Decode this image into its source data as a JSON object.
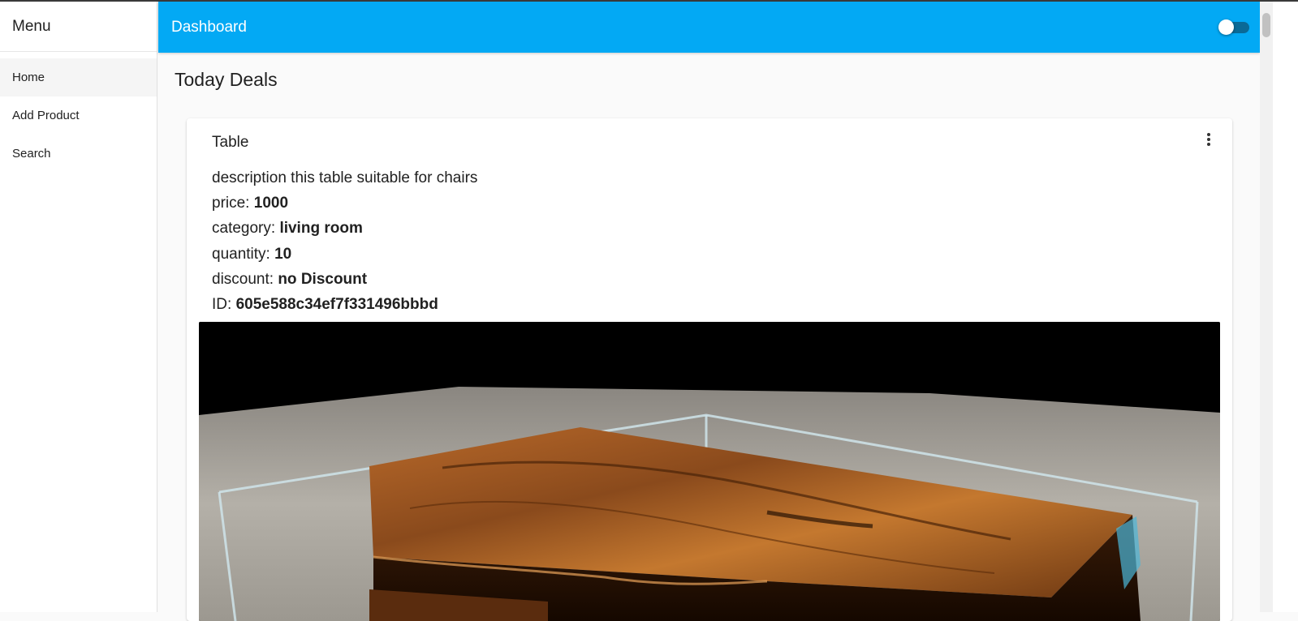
{
  "sidebar": {
    "title": "Menu",
    "items": [
      {
        "label": "Home",
        "active": true
      },
      {
        "label": "Add Product"
      },
      {
        "label": "Search"
      }
    ]
  },
  "appbar": {
    "title": "Dashboard",
    "toggle_on": false
  },
  "main": {
    "section_title": "Today Deals",
    "product": {
      "title": "Table",
      "description_label": "description",
      "description": "this table suitable for chairs",
      "price_label": "price:",
      "price": "1000",
      "category_label": "category:",
      "category": "living room",
      "quantity_label": "quantity:",
      "quantity": "10",
      "discount_label": "discount:",
      "discount": "no Discount",
      "id_label": "ID:",
      "id": "605e588c34ef7f331496bbbd",
      "image_icon": "product-photo"
    }
  },
  "colors": {
    "appbar": "#03a9f4",
    "background": "#fafafa"
  }
}
